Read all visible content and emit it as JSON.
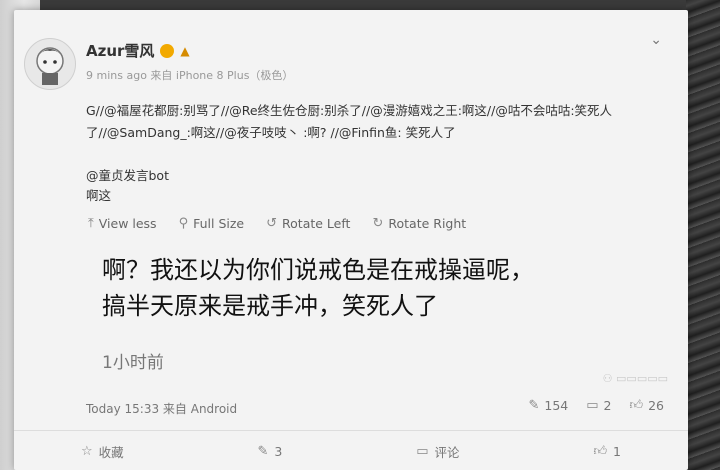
{
  "post": {
    "username": "Azur雪风",
    "meta": "9 mins ago 来自 iPhone 8 Plus（极色）",
    "repost_chain": "G//@福屋花都厨:别骂了//@Re终生佐仓厨:别杀了//@漫游嬉戏之王:啊这//@咕不会咕咕:笑死人了//@SamDang_:啊这//@夜子吱吱丶 :啊? //@Finfin鱼: 笑死人了",
    "at_name": "@童贞发言bot",
    "at_text": "啊这",
    "toolbar": {
      "view_less": "View less",
      "full_size": "Full Size",
      "rotate_left": "Rotate Left",
      "rotate_right": "Rotate Right"
    },
    "image_text_line1": "啊？我还以为你们说戒色是在戒操逼呢，",
    "image_text_line2": "搞半天原来是戒手冲，笑死人了",
    "image_time": "1小时前",
    "footer": "Today 15:33 来自 Android",
    "stats": {
      "reposts": "154",
      "comments": "2",
      "likes": "26"
    }
  },
  "actions": {
    "collect": "收藏",
    "repost": "3",
    "comment": "评论",
    "like": "1"
  },
  "icons": {
    "vip": "vip-badge-icon",
    "level": "level-icon",
    "chevron": "chevron-down-icon"
  },
  "colors": {
    "accent": "#f2a900",
    "text": "#333333",
    "muted": "#777777"
  }
}
